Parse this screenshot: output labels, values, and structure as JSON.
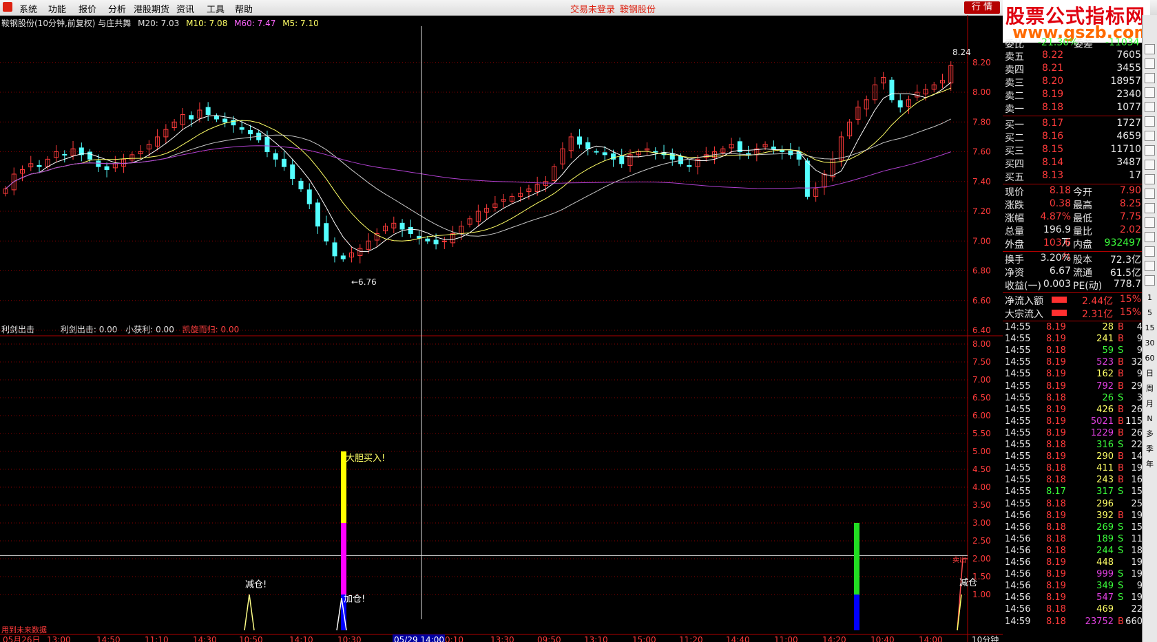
{
  "menu": {
    "items": [
      "系统",
      "功能",
      "报价",
      "分析",
      "港股期货",
      "资讯",
      "工具",
      "帮助"
    ],
    "center_status": "交易未登录",
    "center_stock": "鞍钢股份",
    "quote_button": "行 情"
  },
  "watermark": {
    "line1": "股票公式指标网",
    "line2": "www.gszb.com"
  },
  "chart_header": {
    "title": "鞍钢股份(10分钟,前复权) 与庄共舞",
    "m20": "M20: 7.03",
    "m10": "M10: 7.08",
    "m60": "M60: 7.47",
    "m5": "M5: 7.10"
  },
  "indicator_header": {
    "name": "利剑出击",
    "v1": "利剑出击: 0.00",
    "v2": "小获利: 0.00",
    "v3": "凯旋而归: 0.00"
  },
  "bottom_left_note": "用到未来数据",
  "period_label": "10分钟",
  "crosshair_date": "05/29 14:00",
  "crosshair_value": "2.09",
  "annotations": {
    "high_label": "8.24",
    "low_label": "6.76",
    "bold_buy": "大胆买入!",
    "add_position": "加仓!",
    "reduce1": "减仓!",
    "reduce2": "减仓",
    "sell_short": "卖出"
  },
  "quotes": {
    "top_partial": {
      "label": "委比",
      "value": "-21.30%",
      "label2": "委差",
      "value2": "-11034"
    },
    "asks": [
      {
        "label": "卖五",
        "price": "8.22",
        "vol": "7605"
      },
      {
        "label": "卖四",
        "price": "8.21",
        "vol": "3455"
      },
      {
        "label": "卖三",
        "price": "8.20",
        "vol": "18957"
      },
      {
        "label": "卖二",
        "price": "8.19",
        "vol": "2340"
      },
      {
        "label": "卖一",
        "price": "8.18",
        "vol": "1077"
      }
    ],
    "bids": [
      {
        "label": "买一",
        "price": "8.17",
        "vol": "1727"
      },
      {
        "label": "买二",
        "price": "8.16",
        "vol": "4659"
      },
      {
        "label": "买三",
        "price": "8.15",
        "vol": "11710"
      },
      {
        "label": "买四",
        "price": "8.14",
        "vol": "3487"
      },
      {
        "label": "买五",
        "price": "8.13",
        "vol": "17"
      }
    ],
    "stats": [
      {
        "l1": "现价",
        "v1": "8.18",
        "l2": "今开",
        "v2": "7.90",
        "c1": "#ff3b3b",
        "c2": "#ff3b3b"
      },
      {
        "l1": "涨跌",
        "v1": "0.38",
        "l2": "最高",
        "v2": "8.25",
        "c1": "#ff3b3b",
        "c2": "#ff3b3b"
      },
      {
        "l1": "涨幅",
        "v1": "4.87%",
        "l2": "最低",
        "v2": "7.75",
        "c1": "#ff3b3b",
        "c2": "#ff3b3b"
      },
      {
        "l1": "总量",
        "v1": "196.9万",
        "l2": "量比",
        "v2": "2.02",
        "c1": "#e8e8e8",
        "c2": "#ff3b3b"
      },
      {
        "l1": "外盘",
        "v1": "103.6万",
        "l2": "内盘",
        "v2": "932497",
        "c1": "#ff3b3b",
        "c2": "#3bff3b"
      },
      {
        "l1": "换手",
        "v1": "3.20%",
        "l2": "股本",
        "v2": "72.3亿",
        "c1": "#e8e8e8",
        "c2": "#e8e8e8"
      },
      {
        "l1": "净资",
        "v1": "6.67",
        "l2": "流通",
        "v2": "61.5亿",
        "c1": "#e8e8e8",
        "c2": "#e8e8e8"
      },
      {
        "l1": "收益(一)",
        "v1": "0.003",
        "l2": "PE(动)",
        "v2": "778.7",
        "c1": "#e8e8e8",
        "c2": "#e8e8e8"
      }
    ],
    "flows": [
      {
        "label": "净流入额",
        "value": "2.44亿",
        "pct": "15%"
      },
      {
        "label": "大宗流入",
        "value": "2.31亿",
        "pct": "15%"
      }
    ]
  },
  "ticks": [
    [
      "14:55",
      "8.19",
      "28",
      "B",
      "4"
    ],
    [
      "14:55",
      "8.19",
      "241",
      "B",
      "9"
    ],
    [
      "14:55",
      "8.18",
      "59",
      "S",
      "9"
    ],
    [
      "14:55",
      "8.19",
      "523",
      "B",
      "32"
    ],
    [
      "14:55",
      "8.19",
      "162",
      "B",
      "9"
    ],
    [
      "14:55",
      "8.19",
      "792",
      "B",
      "29"
    ],
    [
      "14:55",
      "8.18",
      "26",
      "S",
      "3"
    ],
    [
      "14:55",
      "8.19",
      "426",
      "B",
      "26"
    ],
    [
      "14:55",
      "8.19",
      "5021",
      "B",
      "115"
    ],
    [
      "14:55",
      "8.19",
      "1229",
      "B",
      "26"
    ],
    [
      "14:55",
      "8.18",
      "316",
      "S",
      "22"
    ],
    [
      "14:55",
      "8.19",
      "290",
      "B",
      "14"
    ],
    [
      "14:55",
      "8.18",
      "411",
      "B",
      "19"
    ],
    [
      "14:55",
      "8.18",
      "243",
      "B",
      "16"
    ],
    [
      "14:55",
      "8.17",
      "317",
      "S",
      "15"
    ],
    [
      "14:55",
      "8.18",
      "296",
      "",
      "25"
    ],
    [
      "14:56",
      "8.19",
      "392",
      "B",
      "19"
    ],
    [
      "14:56",
      "8.18",
      "269",
      "S",
      "15"
    ],
    [
      "14:56",
      "8.18",
      "189",
      "S",
      "11"
    ],
    [
      "14:56",
      "8.18",
      "244",
      "S",
      "18"
    ],
    [
      "14:56",
      "8.19",
      "448",
      "",
      "19"
    ],
    [
      "14:56",
      "8.19",
      "999",
      "S",
      "19"
    ],
    [
      "14:56",
      "8.19",
      "349",
      "S",
      "9"
    ],
    [
      "14:56",
      "8.19",
      "547",
      "S",
      "19"
    ],
    [
      "14:56",
      "8.18",
      "469",
      "",
      "22"
    ],
    [
      "14:59",
      "8.18",
      "23752",
      "B",
      "660"
    ]
  ],
  "sidebar_labels": [
    "1",
    "5",
    "15",
    "30",
    "60",
    "日",
    "周",
    "月",
    "N",
    "多",
    "季",
    "年"
  ],
  "sidebar_icons": [
    "close-icon",
    "down-arrow-icon",
    "chart-icon",
    "list-icon",
    "grid-icon",
    "f10-icon",
    "bar-icon",
    "doc-icon",
    "f2-icon",
    "compare-icon",
    "circle-icon",
    "wave-icon",
    "rsi-icon",
    "move-icon",
    "pencil-icon",
    "fs-icon",
    "green-icon"
  ],
  "colors": {
    "up": "#ff3b3b",
    "down": "#54ffff",
    "ma5": "#ffffff",
    "ma10": "#ffff66",
    "ma20": "#ff66ff",
    "ma60": "#b040d0",
    "grid": "#8b0000"
  },
  "chart_data": [
    {
      "type": "candlestick",
      "title": "鞍钢股份(10分钟,前复权) 与庄共舞",
      "ylim": [
        6.4,
        8.25
      ],
      "y_ticks": [
        "6.40",
        "6.60",
        "6.80",
        "7.00",
        "7.20",
        "7.40",
        "7.60",
        "7.80",
        "8.00",
        "8.20"
      ],
      "x_ticks": [
        "05月26日",
        "13:00",
        "14:50",
        "11:10",
        "14:30",
        "10:50",
        "14:10",
        "10:30",
        "05/29 14:00",
        "0:10",
        "13:30",
        "09:50",
        "13:10",
        "15:00",
        "11:20",
        "14:40",
        "11:00",
        "14:20",
        "10:40",
        "14:00"
      ],
      "close": [
        7.35,
        7.45,
        7.48,
        7.52,
        7.5,
        7.55,
        7.6,
        7.58,
        7.62,
        7.58,
        7.55,
        7.5,
        7.48,
        7.52,
        7.55,
        7.58,
        7.6,
        7.65,
        7.7,
        7.75,
        7.8,
        7.85,
        7.82,
        7.88,
        7.85,
        7.82,
        7.8,
        7.78,
        7.75,
        7.72,
        7.68,
        7.6,
        7.55,
        7.5,
        7.42,
        7.35,
        7.25,
        7.1,
        7.0,
        6.9,
        6.88,
        6.92,
        6.95,
        7.0,
        7.05,
        7.1,
        7.12,
        7.08,
        7.05,
        7.02,
        7.0,
        6.98,
        7.0,
        7.05,
        7.1,
        7.15,
        7.2,
        7.22,
        7.25,
        7.28,
        7.3,
        7.32,
        7.35,
        7.38,
        7.4,
        7.5,
        7.62,
        7.7,
        7.65,
        7.62,
        7.6,
        7.58,
        7.55,
        7.52,
        7.58,
        7.6,
        7.62,
        7.6,
        7.58,
        7.55,
        7.52,
        7.5,
        7.55,
        7.58,
        7.6,
        7.62,
        7.65,
        7.6,
        7.58,
        7.62,
        7.65,
        7.62,
        7.6,
        7.58,
        7.55,
        7.3,
        7.35,
        7.45,
        7.55,
        7.7,
        7.8,
        7.9,
        7.95,
        8.05,
        8.1,
        7.95,
        7.9,
        7.95,
        8.0,
        8.02,
        8.05,
        8.08,
        8.18
      ],
      "ma": [
        {
          "name": "M5",
          "last": 7.1
        },
        {
          "name": "M10",
          "last": 7.08
        },
        {
          "name": "M20",
          "last": 7.03
        },
        {
          "name": "M60",
          "last": 7.47
        }
      ],
      "high": 8.24,
      "low": 6.76
    },
    {
      "type": "bar",
      "title": "利剑出击",
      "ylim": [
        0,
        8.5
      ],
      "y_ticks": [
        "1.00",
        "1.50",
        "2.00",
        "2.50",
        "3.00",
        "3.50",
        "4.00",
        "4.50",
        "5.00",
        "5.50",
        "6.00",
        "6.50",
        "7.00",
        "7.50",
        "8.00"
      ],
      "series": [
        {
          "name": "利剑出击",
          "values": [
            5.0
          ]
        },
        {
          "name": "小获利",
          "values": [
            3.0
          ]
        },
        {
          "name": "凯旋而归",
          "values": [
            2.0
          ]
        }
      ]
    }
  ]
}
